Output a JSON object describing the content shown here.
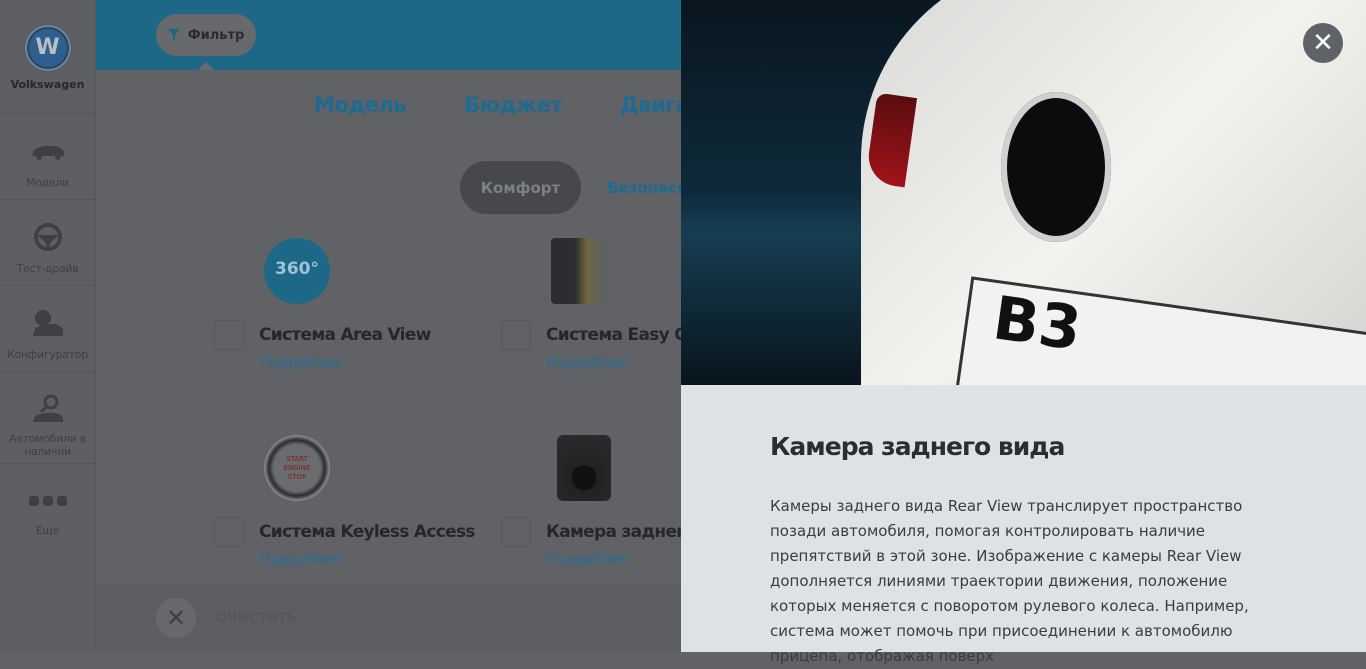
{
  "sidebar": {
    "brand": "Volkswagen",
    "items": [
      {
        "label": "Модели"
      },
      {
        "label": "Тест-драйв"
      },
      {
        "label": "Конфигуратор"
      },
      {
        "label": "Автомобили в наличии"
      },
      {
        "label": "Еще"
      }
    ]
  },
  "header": {
    "filter_label": "Фильтр"
  },
  "tabs": [
    "Модель",
    "Бюджет",
    "Двигатель"
  ],
  "subtabs": {
    "active": "Комфорт",
    "other": "Безопасность"
  },
  "features": [
    {
      "title": "Система Area View",
      "link": "Подробнее",
      "icon_text": "360°"
    },
    {
      "title": "Система Easy Open",
      "link": "Подробнее"
    },
    {
      "title": "Система Keyless Access",
      "link": "Подробнее",
      "icon_text": "START ENGINE STOP"
    },
    {
      "title": "Камера заднего вида",
      "link": "Подробнее"
    }
  ],
  "footer": {
    "clear_label": "ОЧИСТИТЬ"
  },
  "panel": {
    "title": "Камера заднего вида",
    "text": "Камеры заднего вида Rear View транслирует пространство позади автомобиля, помогая контролировать наличие препятствий в этой зоне. Изображение с камеры Rear View дополняется линиями траектории движения, положение которых меняется с поворотом рулевого колеса. Например, система может помочь при присоединении к автомобилю прицепа, отображая поверх",
    "plate_text": "B3"
  }
}
